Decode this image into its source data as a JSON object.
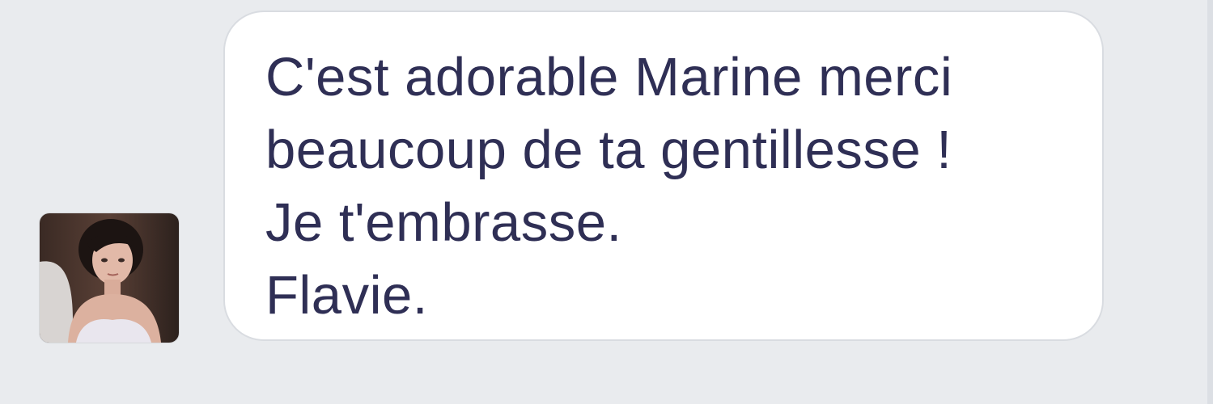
{
  "conversation": {
    "message": {
      "sender_avatar_icon": "person-avatar-icon",
      "lines": [
        "C'est adorable Marine merci",
        "beaucoup de ta gentillesse !",
        "Je t'embrasse.",
        "Flavie."
      ]
    }
  },
  "colors": {
    "background": "#e9ebee",
    "bubble": "#ffffff",
    "bubble_border": "#d9dce1",
    "text": "#2f2f55"
  }
}
